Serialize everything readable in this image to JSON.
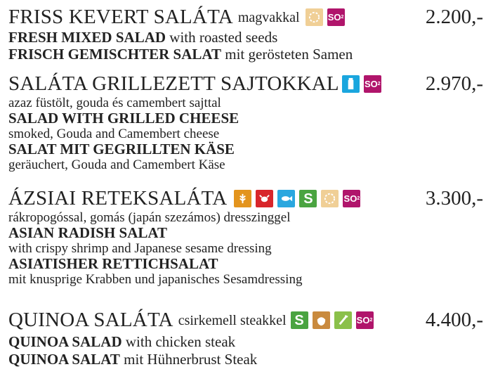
{
  "items": [
    {
      "title": "FRISS KEVERT SALÁTA",
      "title_desc": "magvakkal",
      "price": "2.200,-",
      "icons": [
        {
          "name": "seeds-icon",
          "color": "#f0cf96"
        },
        {
          "name": "sulphites-icon",
          "label": "SO",
          "color": "#b0156b"
        }
      ],
      "lines": [
        {
          "bold": "FRESH MIXED SALAD",
          "rest": " with roasted seeds"
        },
        {
          "bold": "FRISCH GEMISCHTER SALAT",
          "rest": " mit gerösteten Samen"
        }
      ]
    },
    {
      "title": "SALÁTA GRILLEZETT SAJTOKKAL",
      "price": "2.970,-",
      "icons": [
        {
          "name": "milk-icon",
          "color": "#1aa6de"
        },
        {
          "name": "sulphites-icon",
          "label": "SO",
          "color": "#b0156b"
        }
      ],
      "lines": [
        {
          "plain": "azaz füstölt, gouda és camembert sajttal"
        },
        {
          "bold": "SALAD WITH GRILLED CHEESE"
        },
        {
          "plain": "smoked, Gouda and Camembert cheese"
        },
        {
          "bold": "SALAT MIT GEGRILLTEN KÄSE"
        },
        {
          "plain": "geräuchert, Gouda and Camembert Käse"
        }
      ]
    },
    {
      "title": "ÁZSIAI RETEKSALÁTA",
      "price": "3.300,-",
      "icons": [
        {
          "name": "gluten-icon",
          "color": "#e3941d"
        },
        {
          "name": "crustacean-icon",
          "color": "#d8262b"
        },
        {
          "name": "fish-icon",
          "color": "#2aa7df"
        },
        {
          "name": "soy-icon",
          "label": "S",
          "color": "#4aa441"
        },
        {
          "name": "sesame-icon",
          "color": "#f0cf96"
        },
        {
          "name": "sulphites-icon",
          "label": "SO",
          "color": "#b0156b"
        }
      ],
      "lines": [
        {
          "plain": "rákropogóssal, gomás (japán szezámos) dresszinggel"
        },
        {
          "bold": "ASIAN RADISH SALAT"
        },
        {
          "plain": "with crispy shrimp and Japanese sesame dressing"
        },
        {
          "bold": "ASIATISHER RETTICHSALAT"
        },
        {
          "plain": "mit knusprige Krabben und japanisches Sesamdressing"
        }
      ]
    },
    {
      "title": "QUINOA SALÁTA",
      "title_desc": "csirkemell steakkel",
      "price": "4.400,-",
      "icons": [
        {
          "name": "soy-icon",
          "label": "S",
          "color": "#4aa441"
        },
        {
          "name": "nuts-icon",
          "color": "#c98a3e"
        },
        {
          "name": "celery-icon",
          "color": "#8bc04a"
        },
        {
          "name": "sulphites-icon",
          "label": "SO",
          "color": "#b0156b"
        }
      ],
      "lines": [
        {
          "bold": "QUINOA SALAD",
          "rest": " with chicken steak"
        },
        {
          "bold": "QUINOA SALAT",
          "rest": " mit Hühnerbrust Steak"
        }
      ]
    }
  ]
}
